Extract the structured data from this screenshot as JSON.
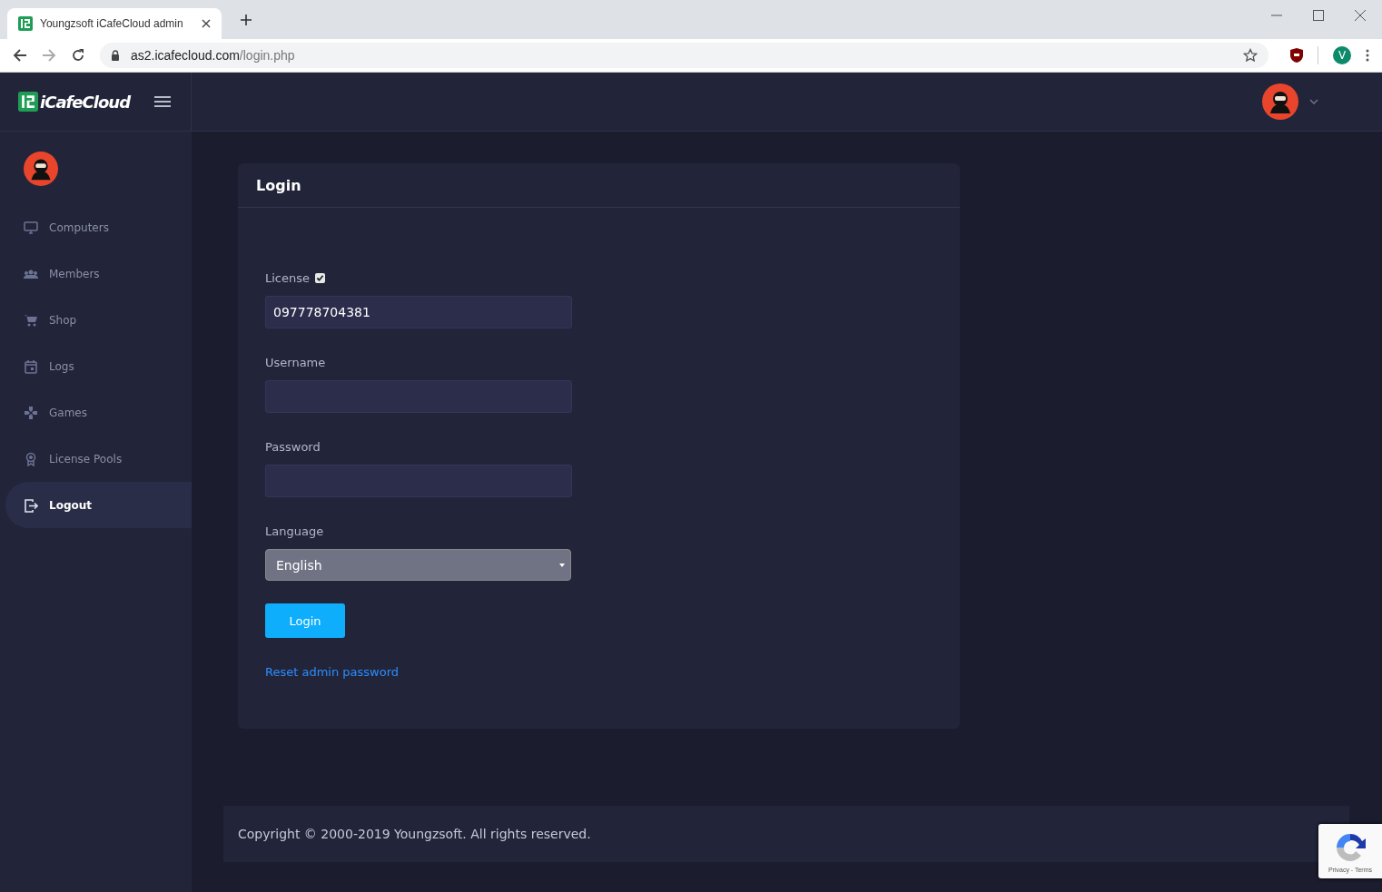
{
  "browser": {
    "tab_title": "Youngzsoft iCafeCloud admin",
    "url_host": "as2.icafecloud.com",
    "url_path": "/login.php",
    "profile_initial": "V"
  },
  "header": {
    "logo": "iCafeCloud"
  },
  "sidebar": {
    "items": [
      {
        "label": "Computers",
        "selected": false
      },
      {
        "label": "Members",
        "selected": false
      },
      {
        "label": "Shop",
        "selected": false
      },
      {
        "label": "Logs",
        "selected": false
      },
      {
        "label": "Games",
        "selected": false
      },
      {
        "label": "License Pools",
        "selected": false
      },
      {
        "label": "Logout",
        "selected": true
      }
    ]
  },
  "login": {
    "title": "Login",
    "license": {
      "label": "License",
      "checked": true,
      "value": "097778704381"
    },
    "username": {
      "label": "Username"
    },
    "password": {
      "label": "Password"
    },
    "language": {
      "label": "Language",
      "value": "English"
    },
    "button": "Login",
    "reset_link": "Reset admin password"
  },
  "footer": {
    "copyright": "Copyright © 2000-2019 Youngzsoft. All rights reserved."
  },
  "recaptcha": {
    "links": "Privacy - Terms"
  }
}
